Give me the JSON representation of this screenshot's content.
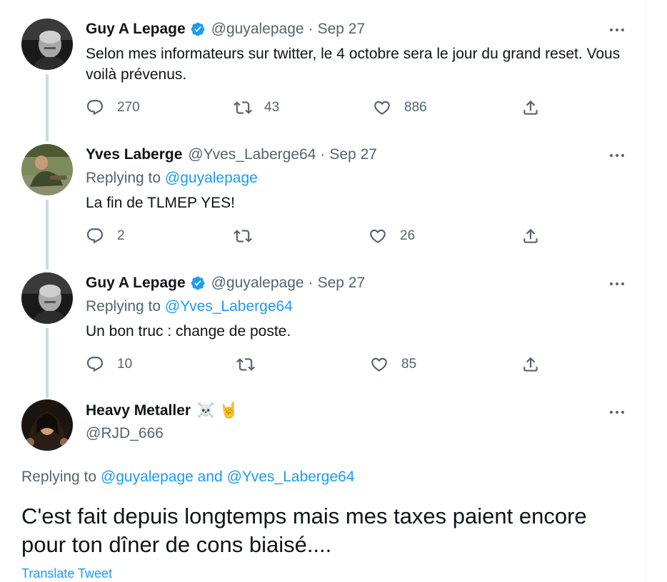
{
  "tweets": [
    {
      "name": "Guy A Lepage",
      "verified": true,
      "handle": "@guyalepage",
      "date": "Sep 27",
      "text": "Selon mes informateurs sur twitter, le 4 octobre sera le jour du grand reset. Vous voilà prévenus.",
      "replies": "270",
      "retweets": "43",
      "likes": "886"
    },
    {
      "name": "Yves Laberge",
      "verified": false,
      "handle": "@Yves_Laberge64",
      "date": "Sep 27",
      "replying_label": "Replying to",
      "replying_handle": "@guyalepage",
      "text": "La fin de TLMEP YES!",
      "replies": "2",
      "retweets": "",
      "likes": "26"
    },
    {
      "name": "Guy A Lepage",
      "verified": true,
      "handle": "@guyalepage",
      "date": "Sep 27",
      "replying_label": "Replying to",
      "replying_handle": "@Yves_Laberge64",
      "text": "Un bon truc : change de poste.",
      "replies": "10",
      "retweets": "",
      "likes": "85"
    }
  ],
  "main_tweet": {
    "name": "Heavy Metaller",
    "name_emoji": "☠️ 🤘",
    "handle": "@RJD_666",
    "replying_label": "Replying to",
    "replying_handle_1": "@guyalepage",
    "replying_and": "and",
    "replying_handle_2": "@Yves_Laberge64",
    "text": "C'est fait depuis longtemps mais mes taxes paient encore pour ton dîner de cons biaisé....",
    "translate_label": "Translate Tweet"
  },
  "separator": "·",
  "colors": {
    "accent": "#1d9bf0",
    "secondary_text": "#536471",
    "primary_text": "#0f1419",
    "thread_line": "#cfd9de"
  },
  "icons": {
    "reply": "reply-icon",
    "retweet": "retweet-icon",
    "like": "heart-icon",
    "share": "share-icon",
    "verified": "verified-badge-icon",
    "more": "more-icon"
  }
}
